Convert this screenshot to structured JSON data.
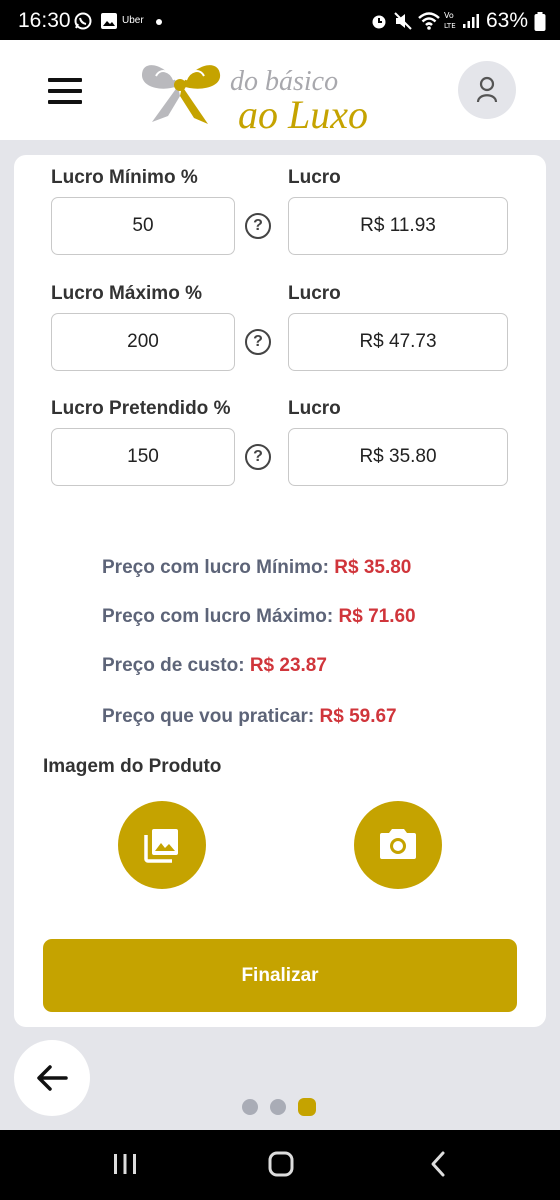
{
  "status_bar": {
    "time": "16:30",
    "notification_text": "Uber",
    "battery_percent": "63%"
  },
  "header": {
    "logo_text_top": "do básico",
    "logo_text_bottom": "ao Luxo"
  },
  "profit_rows": [
    {
      "label": "Lucro Mínimo %",
      "percent_value": "50",
      "result_label": "Lucro",
      "result_value": "R$ 11.93"
    },
    {
      "label": "Lucro Máximo %",
      "percent_value": "200",
      "result_label": "Lucro",
      "result_value": "R$ 47.73"
    },
    {
      "label": "Lucro Pretendido %",
      "percent_value": "150",
      "result_label": "Lucro",
      "result_value": "R$ 35.80"
    }
  ],
  "summary": [
    {
      "label": "Preço com lucro Mínimo:",
      "value": "R$ 35.80"
    },
    {
      "label": "Preço com lucro Máximo:",
      "value": "R$ 71.60"
    },
    {
      "label": "Preço de custo:",
      "value": "R$ 23.87"
    },
    {
      "label": "Preço que vou praticar:",
      "value": "R$ 59.67"
    }
  ],
  "product_image": {
    "label": "Imagem do Produto",
    "gallery_icon": "photo-library-icon",
    "camera_icon": "camera-icon"
  },
  "finalize_label": "Finalizar",
  "pagination": {
    "total": 3,
    "current": 3
  },
  "colors": {
    "accent": "#c5a300",
    "price_red": "#d0353b",
    "summary_text": "#5d6478",
    "background": "#e4e5ea"
  }
}
